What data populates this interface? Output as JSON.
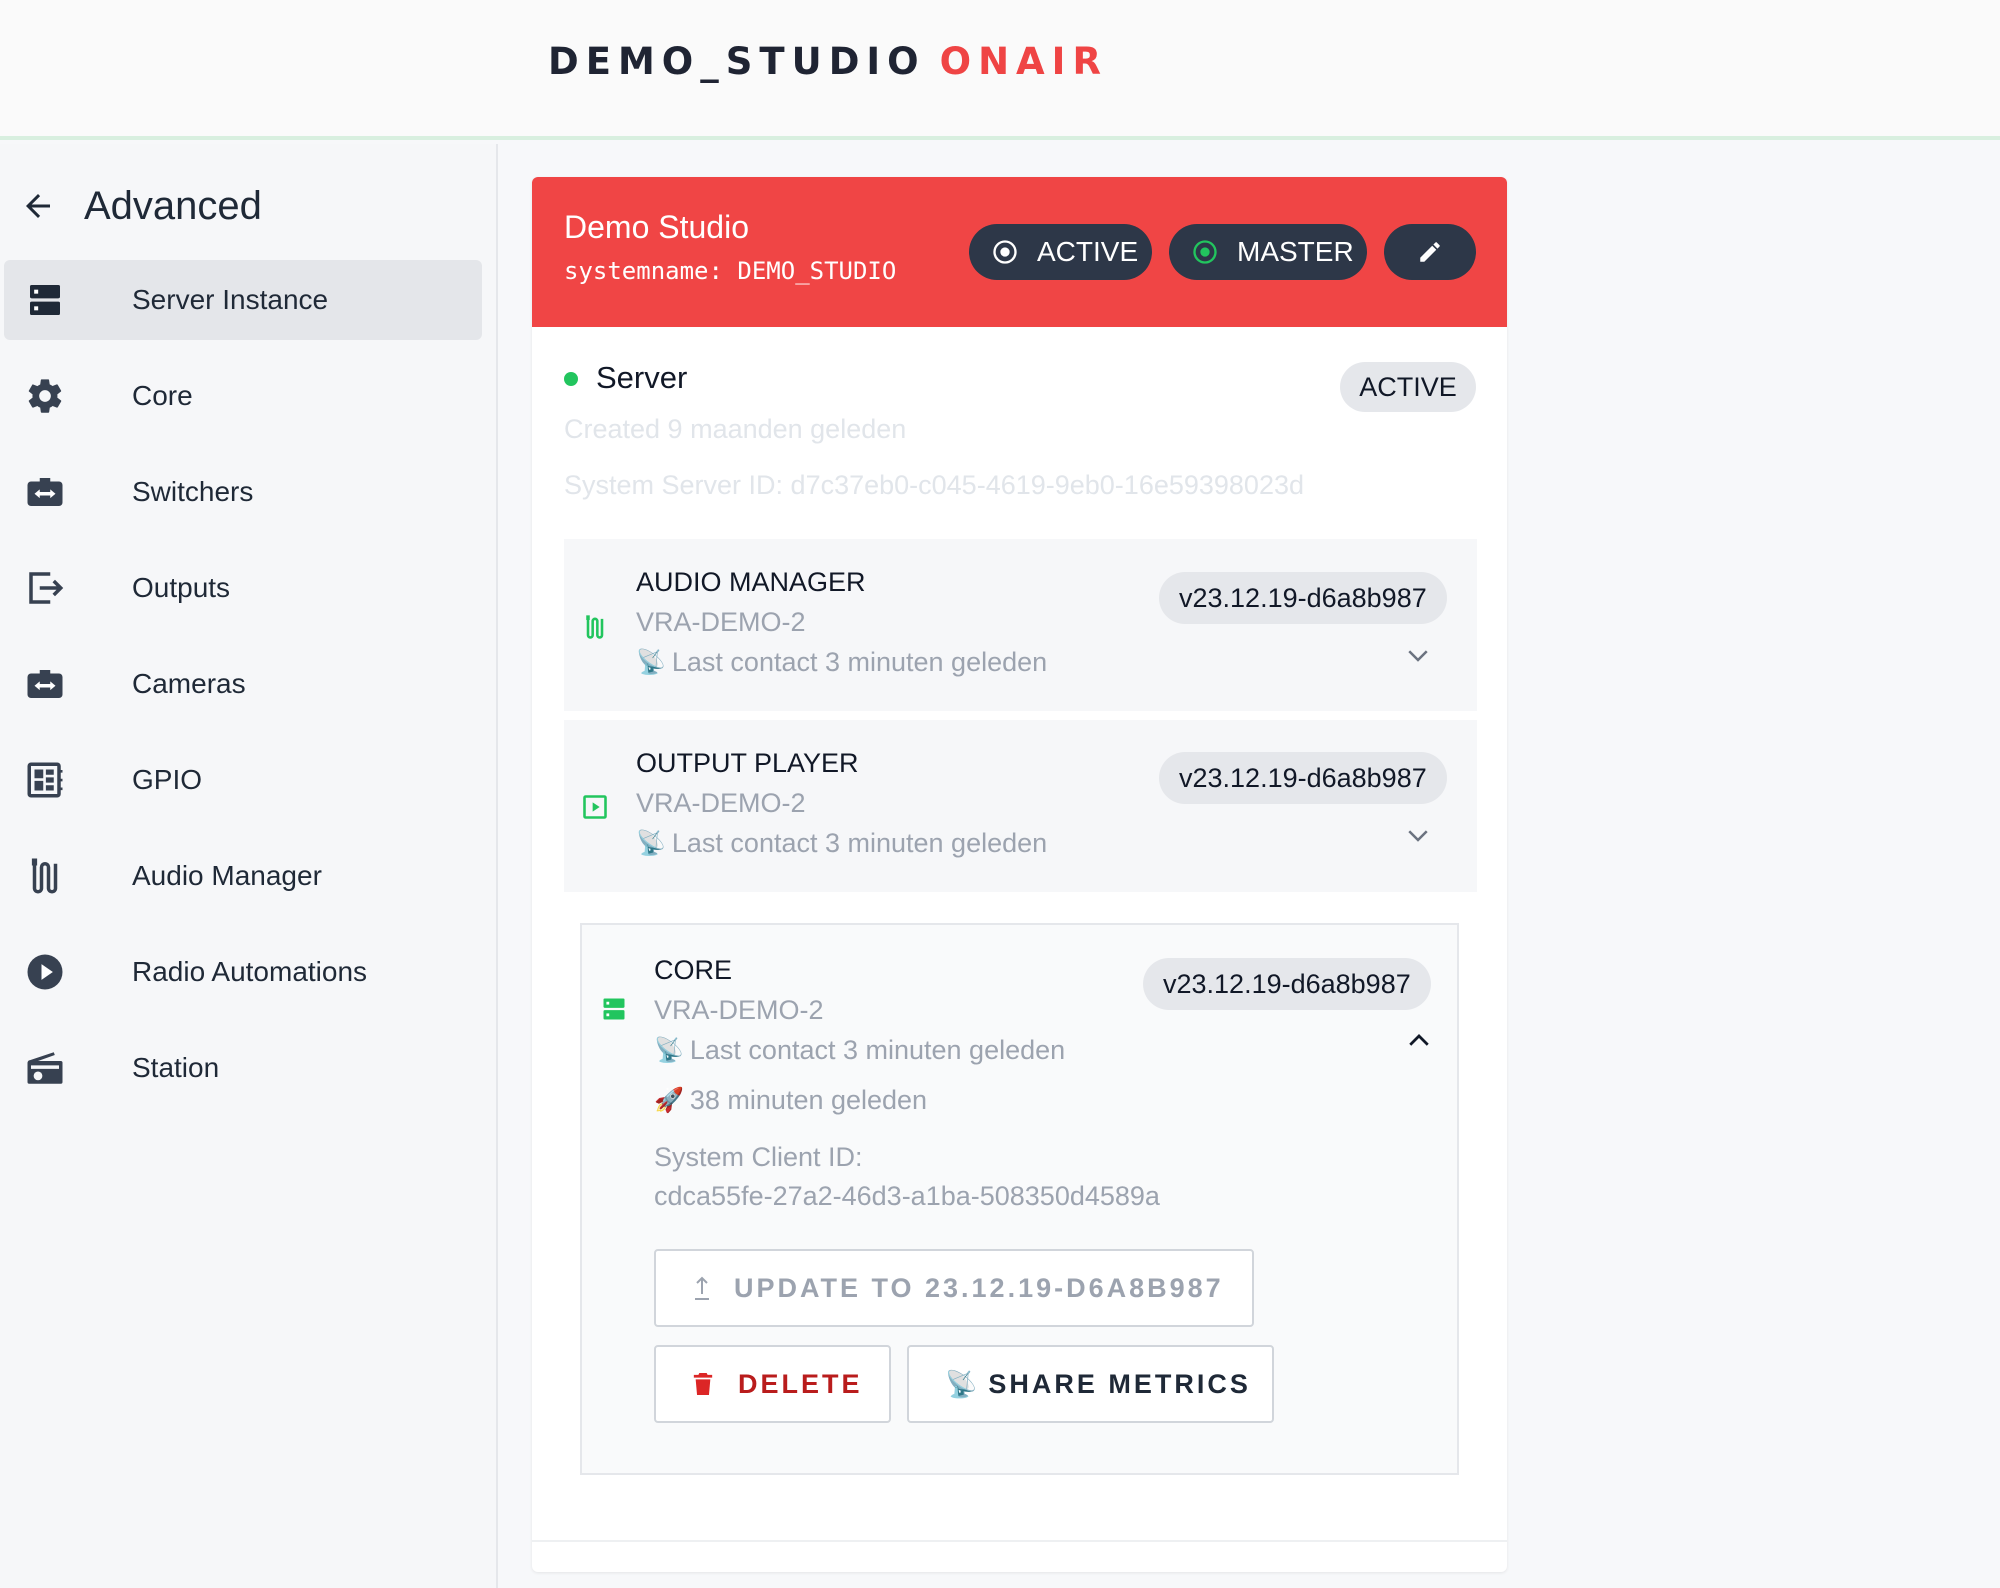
{
  "brand": {
    "name": "DEMO_STUDIO",
    "suffix": "ONAIR"
  },
  "sidebar": {
    "title": "Advanced",
    "items": [
      {
        "label": "Server Instance",
        "icon": "server-icon",
        "active": true
      },
      {
        "label": "Core",
        "icon": "gear-icon"
      },
      {
        "label": "Switchers",
        "icon": "switcher-icon"
      },
      {
        "label": "Outputs",
        "icon": "output-icon"
      },
      {
        "label": "Cameras",
        "icon": "camera-icon"
      },
      {
        "label": "GPIO",
        "icon": "gpio-icon"
      },
      {
        "label": "Audio Manager",
        "icon": "audio-icon"
      },
      {
        "label": "Radio Automations",
        "icon": "play-icon"
      },
      {
        "label": "Station",
        "icon": "radio-icon"
      }
    ]
  },
  "header": {
    "title": "Demo Studio",
    "systemname": "systemname: DEMO_STUDIO",
    "active_label": "ACTIVE",
    "master_label": "MASTER",
    "colors": {
      "header_bg": "#f04545",
      "pill_bg": "#2d3748",
      "status_green": "#22c55e"
    }
  },
  "server": {
    "name": "Server",
    "status": "ACTIVE",
    "created": "Created 9 maanden geleden",
    "system_id": "System Server ID: d7c37eb0-c045-4619-9eb0-16e59398023d"
  },
  "components": [
    {
      "name": "AUDIO MANAGER",
      "host": "VRA-DEMO-2",
      "contact_emoji": "📡",
      "contact": "Last contact 3 minuten geleden",
      "version": "v23.12.19-d6a8b987",
      "expanded": false
    },
    {
      "name": "OUTPUT PLAYER",
      "host": "VRA-DEMO-2",
      "contact_emoji": "📡",
      "contact": "Last contact 3 minuten geleden",
      "version": "v23.12.19-d6a8b987",
      "expanded": false
    }
  ],
  "core": {
    "name": "CORE",
    "host": "VRA-DEMO-2",
    "contact_emoji": "📡",
    "contact": "Last contact 3 minuten geleden",
    "started_emoji": "🚀",
    "started": "38 minuten geleden",
    "client_id_label": "System Client ID:",
    "client_id": "cdca55fe-27a2-46d3-a1ba-508350d4589a",
    "version": "v23.12.19-d6a8b987",
    "expanded": true,
    "update_button": "UPDATE TO 23.12.19-D6A8B987",
    "delete_button": "DELETE",
    "share_emoji": "📡",
    "share_button": "SHARE METRICS"
  }
}
